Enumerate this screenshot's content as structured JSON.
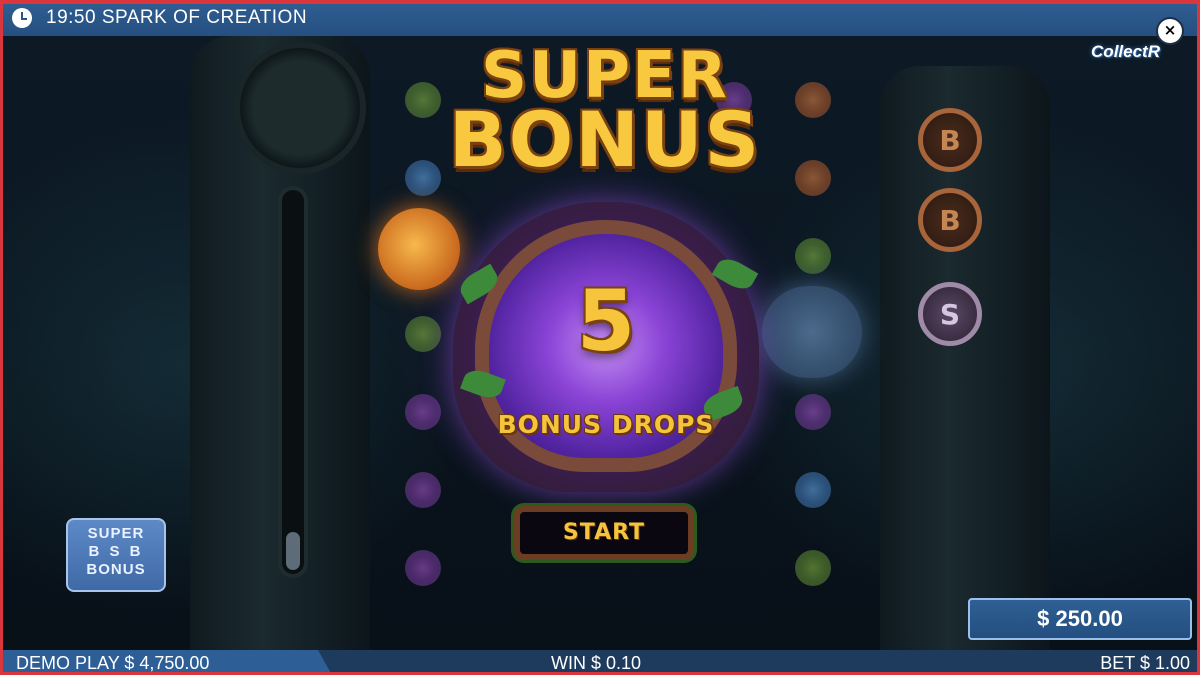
{
  "header": {
    "time": "19:50",
    "title": "SPARK OF CREATION"
  },
  "brand": {
    "logo_text": "CollectR"
  },
  "close": {
    "symbol": "×"
  },
  "feature_badge": {
    "line1": "SUPER",
    "line2": "B S B",
    "line3": "BONUS"
  },
  "popup": {
    "title_line1": "SUPER",
    "title_line2": "BONUS",
    "count": "5",
    "subtitle": "BONUS DROPS",
    "start_label": "START"
  },
  "collect_coins": [
    "B",
    "B",
    "S"
  ],
  "meter": {
    "fill_fraction": 0.1
  },
  "balance_box": {
    "value": "$ 250.00"
  },
  "footer": {
    "demo_label": "DEMO PLAY $ 4,750.00",
    "win_label": "WIN $ 0.10",
    "bet_label": "BET $ 1.00"
  },
  "colors": {
    "bar_blue": "#2f5f94",
    "gold": "#f8c83e",
    "frame_red": "#d9363e"
  }
}
